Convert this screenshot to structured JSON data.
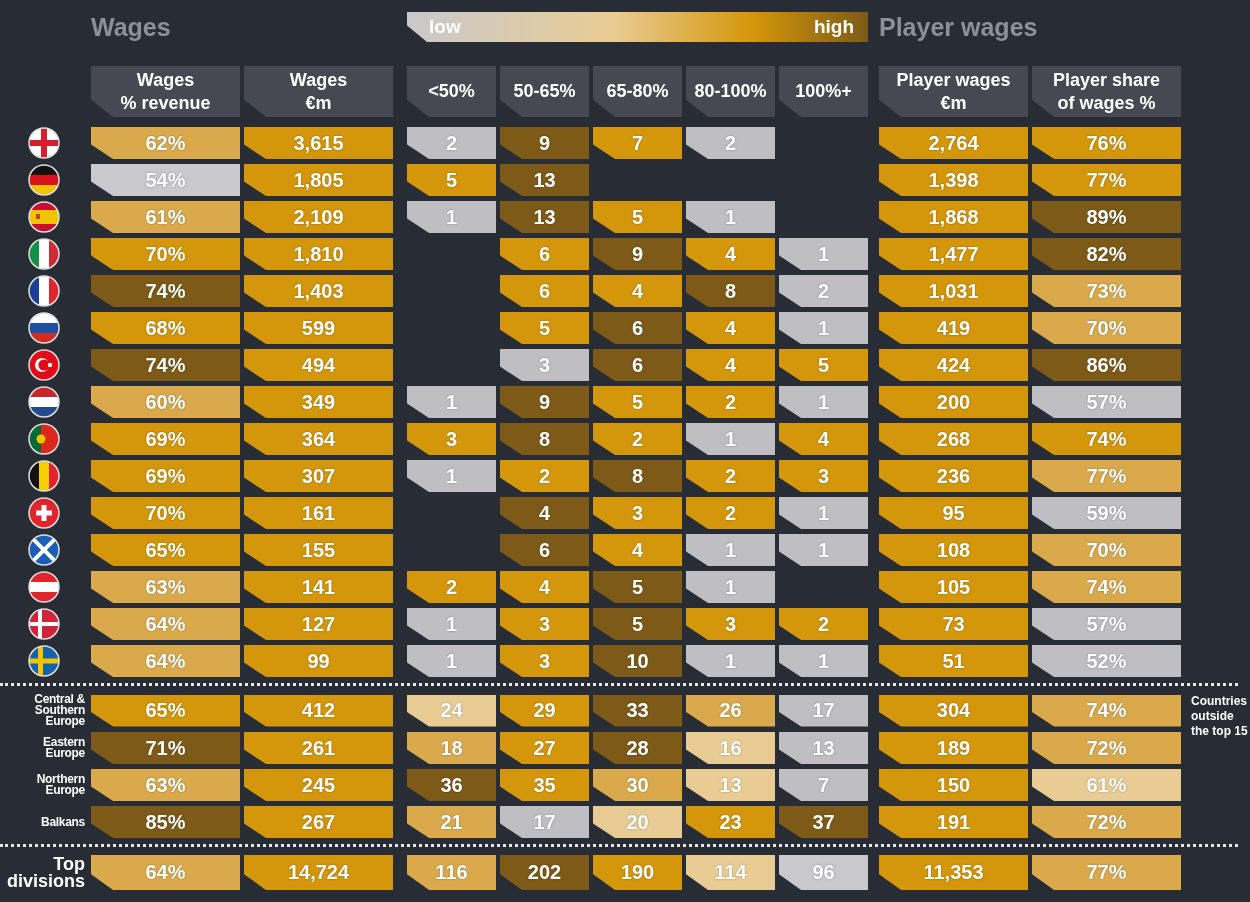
{
  "title": "Wages",
  "legend": {
    "low": "low",
    "high": "high"
  },
  "player_title": "Player wages",
  "columns": [
    "Wages\n% revenue",
    "Wages\n€m",
    "<50%",
    "50-65%",
    "65-80%",
    "80-100%",
    "100%+",
    "Player wages\n€m",
    "Player share\nof wages %"
  ],
  "countries": [
    {
      "cells": [
        {
          "value": "62%",
          "color": "#d9a94c"
        },
        {
          "value": "3,615",
          "color": "#d4960a"
        },
        {
          "value": "2",
          "color": "#bfbfc3"
        },
        {
          "value": "9",
          "color": "#7d5a17"
        },
        {
          "value": "7",
          "color": "#d4960a"
        },
        {
          "value": "2",
          "color": "#bfbfc3"
        },
        null,
        {
          "value": "2,764",
          "color": "#d4960a"
        },
        {
          "value": "76%",
          "color": "#d4960a"
        }
      ]
    },
    {
      "cells": [
        {
          "value": "54%",
          "color": "#c9c9cd"
        },
        {
          "value": "1,805",
          "color": "#d4960a"
        },
        {
          "value": "5",
          "color": "#d4960a"
        },
        {
          "value": "13",
          "color": "#7d5a17"
        },
        null,
        null,
        null,
        {
          "value": "1,398",
          "color": "#d4960a"
        },
        {
          "value": "77%",
          "color": "#d4960a"
        }
      ]
    },
    {
      "cells": [
        {
          "value": "61%",
          "color": "#d9a94c"
        },
        {
          "value": "2,109",
          "color": "#d4960a"
        },
        {
          "value": "1",
          "color": "#bfbfc3"
        },
        {
          "value": "13",
          "color": "#7d5a17"
        },
        {
          "value": "5",
          "color": "#d4960a"
        },
        {
          "value": "1",
          "color": "#bfbfc3"
        },
        null,
        {
          "value": "1,868",
          "color": "#d4960a"
        },
        {
          "value": "89%",
          "color": "#7d5a17"
        }
      ]
    },
    {
      "cells": [
        {
          "value": "70%",
          "color": "#d4960a"
        },
        {
          "value": "1,810",
          "color": "#d4960a"
        },
        null,
        {
          "value": "6",
          "color": "#d4960a"
        },
        {
          "value": "9",
          "color": "#7d5a17"
        },
        {
          "value": "4",
          "color": "#d4960a"
        },
        {
          "value": "1",
          "color": "#bfbfc3"
        },
        {
          "value": "1,477",
          "color": "#d4960a"
        },
        {
          "value": "82%",
          "color": "#7d5a17"
        }
      ]
    },
    {
      "cells": [
        {
          "value": "74%",
          "color": "#7d5a17"
        },
        {
          "value": "1,403",
          "color": "#d4960a"
        },
        null,
        {
          "value": "6",
          "color": "#d4960a"
        },
        {
          "value": "4",
          "color": "#d4960a"
        },
        {
          "value": "8",
          "color": "#7d5a17"
        },
        {
          "value": "2",
          "color": "#bfbfc3"
        },
        {
          "value": "1,031",
          "color": "#d4960a"
        },
        {
          "value": "73%",
          "color": "#d9a94c"
        }
      ]
    },
    {
      "cells": [
        {
          "value": "68%",
          "color": "#d4960a"
        },
        {
          "value": "599",
          "color": "#d4960a"
        },
        null,
        {
          "value": "5",
          "color": "#d4960a"
        },
        {
          "value": "6",
          "color": "#7d5a17"
        },
        {
          "value": "4",
          "color": "#d4960a"
        },
        {
          "value": "1",
          "color": "#bfbfc3"
        },
        {
          "value": "419",
          "color": "#d4960a"
        },
        {
          "value": "70%",
          "color": "#d9a94c"
        }
      ]
    },
    {
      "cells": [
        {
          "value": "74%",
          "color": "#7d5a17"
        },
        {
          "value": "494",
          "color": "#d4960a"
        },
        null,
        {
          "value": "3",
          "color": "#bfbfc3"
        },
        {
          "value": "6",
          "color": "#7d5a17"
        },
        {
          "value": "4",
          "color": "#d4960a"
        },
        {
          "value": "5",
          "color": "#d4960a"
        },
        {
          "value": "424",
          "color": "#d4960a"
        },
        {
          "value": "86%",
          "color": "#7d5a17"
        }
      ]
    },
    {
      "cells": [
        {
          "value": "60%",
          "color": "#d9a94c"
        },
        {
          "value": "349",
          "color": "#d4960a"
        },
        {
          "value": "1",
          "color": "#bfbfc3"
        },
        {
          "value": "9",
          "color": "#7d5a17"
        },
        {
          "value": "5",
          "color": "#d4960a"
        },
        {
          "value": "2",
          "color": "#d4960a"
        },
        {
          "value": "1",
          "color": "#bfbfc3"
        },
        {
          "value": "200",
          "color": "#d4960a"
        },
        {
          "value": "57%",
          "color": "#bfbfc3"
        }
      ]
    },
    {
      "cells": [
        {
          "value": "69%",
          "color": "#d4960a"
        },
        {
          "value": "364",
          "color": "#d4960a"
        },
        {
          "value": "3",
          "color": "#d4960a"
        },
        {
          "value": "8",
          "color": "#7d5a17"
        },
        {
          "value": "2",
          "color": "#d4960a"
        },
        {
          "value": "1",
          "color": "#bfbfc3"
        },
        {
          "value": "4",
          "color": "#d4960a"
        },
        {
          "value": "268",
          "color": "#d4960a"
        },
        {
          "value": "74%",
          "color": "#d4960a"
        }
      ]
    },
    {
      "cells": [
        {
          "value": "69%",
          "color": "#d4960a"
        },
        {
          "value": "307",
          "color": "#d4960a"
        },
        {
          "value": "1",
          "color": "#bfbfc3"
        },
        {
          "value": "2",
          "color": "#d4960a"
        },
        {
          "value": "8",
          "color": "#7d5a17"
        },
        {
          "value": "2",
          "color": "#d4960a"
        },
        {
          "value": "3",
          "color": "#d4960a"
        },
        {
          "value": "236",
          "color": "#d4960a"
        },
        {
          "value": "77%",
          "color": "#d9a94c"
        }
      ]
    },
    {
      "cells": [
        {
          "value": "70%",
          "color": "#d4960a"
        },
        {
          "value": "161",
          "color": "#d4960a"
        },
        null,
        {
          "value": "4",
          "color": "#7d5a17"
        },
        {
          "value": "3",
          "color": "#d4960a"
        },
        {
          "value": "2",
          "color": "#d4960a"
        },
        {
          "value": "1",
          "color": "#bfbfc3"
        },
        {
          "value": "95",
          "color": "#d4960a"
        },
        {
          "value": "59%",
          "color": "#bfbfc3"
        }
      ]
    },
    {
      "cells": [
        {
          "value": "65%",
          "color": "#d4960a"
        },
        {
          "value": "155",
          "color": "#d4960a"
        },
        null,
        {
          "value": "6",
          "color": "#7d5a17"
        },
        {
          "value": "4",
          "color": "#d4960a"
        },
        {
          "value": "1",
          "color": "#bfbfc3"
        },
        {
          "value": "1",
          "color": "#bfbfc3"
        },
        {
          "value": "108",
          "color": "#d4960a"
        },
        {
          "value": "70%",
          "color": "#d9a94c"
        }
      ]
    },
    {
      "cells": [
        {
          "value": "63%",
          "color": "#d9a94c"
        },
        {
          "value": "141",
          "color": "#d4960a"
        },
        {
          "value": "2",
          "color": "#d4960a"
        },
        {
          "value": "4",
          "color": "#d4960a"
        },
        {
          "value": "5",
          "color": "#7d5a17"
        },
        {
          "value": "1",
          "color": "#bfbfc3"
        },
        null,
        {
          "value": "105",
          "color": "#d4960a"
        },
        {
          "value": "74%",
          "color": "#d9a94c"
        }
      ]
    },
    {
      "cells": [
        {
          "value": "64%",
          "color": "#d9a94c"
        },
        {
          "value": "127",
          "color": "#d4960a"
        },
        {
          "value": "1",
          "color": "#bfbfc3"
        },
        {
          "value": "3",
          "color": "#d4960a"
        },
        {
          "value": "5",
          "color": "#7d5a17"
        },
        {
          "value": "3",
          "color": "#d4960a"
        },
        {
          "value": "2",
          "color": "#d4960a"
        },
        {
          "value": "73",
          "color": "#d4960a"
        },
        {
          "value": "57%",
          "color": "#bfbfc3"
        }
      ]
    },
    {
      "cells": [
        {
          "value": "64%",
          "color": "#d9a94c"
        },
        {
          "value": "99",
          "color": "#d4960a"
        },
        {
          "value": "1",
          "color": "#bfbfc3"
        },
        {
          "value": "3",
          "color": "#d4960a"
        },
        {
          "value": "10",
          "color": "#7d5a17"
        },
        {
          "value": "1",
          "color": "#bfbfc3"
        },
        {
          "value": "1",
          "color": "#bfbfc3"
        },
        {
          "value": "51",
          "color": "#d4960a"
        },
        {
          "value": "52%",
          "color": "#bfbfc3"
        }
      ]
    }
  ],
  "regions": [
    {
      "label": "Central &\nSouthern\nEurope",
      "cells": [
        {
          "value": "65%",
          "color": "#d4960a"
        },
        {
          "value": "412",
          "color": "#d4960a"
        },
        {
          "value": "24",
          "color": "#e9cc94"
        },
        {
          "value": "29",
          "color": "#d4960a"
        },
        {
          "value": "33",
          "color": "#7d5a17"
        },
        {
          "value": "26",
          "color": "#d9a94c"
        },
        {
          "value": "17",
          "color": "#bfbfc3"
        },
        {
          "value": "304",
          "color": "#d4960a"
        },
        {
          "value": "74%",
          "color": "#d9a94c"
        }
      ]
    },
    {
      "label": "Eastern\nEurope",
      "cells": [
        {
          "value": "71%",
          "color": "#7d5a17"
        },
        {
          "value": "261",
          "color": "#d4960a"
        },
        {
          "value": "18",
          "color": "#d9a94c"
        },
        {
          "value": "27",
          "color": "#d4960a"
        },
        {
          "value": "28",
          "color": "#7d5a17"
        },
        {
          "value": "16",
          "color": "#e9cc94"
        },
        {
          "value": "13",
          "color": "#bfbfc3"
        },
        {
          "value": "189",
          "color": "#d4960a"
        },
        {
          "value": "72%",
          "color": "#d9a94c"
        }
      ]
    },
    {
      "label": "Northern\nEurope",
      "cells": [
        {
          "value": "63%",
          "color": "#d9a94c"
        },
        {
          "value": "245",
          "color": "#d4960a"
        },
        {
          "value": "36",
          "color": "#7d5a17"
        },
        {
          "value": "35",
          "color": "#d4960a"
        },
        {
          "value": "30",
          "color": "#d9a94c"
        },
        {
          "value": "13",
          "color": "#e9cc94"
        },
        {
          "value": "7",
          "color": "#bfbfc3"
        },
        {
          "value": "150",
          "color": "#d4960a"
        },
        {
          "value": "61%",
          "color": "#e9cc94"
        }
      ]
    },
    {
      "label": "Balkans",
      "cells": [
        {
          "value": "85%",
          "color": "#7d5a17"
        },
        {
          "value": "267",
          "color": "#d4960a"
        },
        {
          "value": "21",
          "color": "#d9a94c"
        },
        {
          "value": "17",
          "color": "#bfbfc3"
        },
        {
          "value": "20",
          "color": "#e9cc94"
        },
        {
          "value": "23",
          "color": "#d4960a"
        },
        {
          "value": "37",
          "color": "#7d5a17"
        },
        {
          "value": "191",
          "color": "#d4960a"
        },
        {
          "value": "72%",
          "color": "#d9a94c"
        }
      ]
    }
  ],
  "regions_note": "Countries outside the top 15",
  "total": {
    "label": "Top\ndivisions",
    "cells": [
      {
        "value": "64%",
        "color": "#d9a94c"
      },
      {
        "value": "14,724",
        "color": "#d4960a"
      },
      {
        "value": "116",
        "color": "#d9a94c"
      },
      {
        "value": "202",
        "color": "#7d5a17"
      },
      {
        "value": "190",
        "color": "#d4960a"
      },
      {
        "value": "114",
        "color": "#e9cc94"
      },
      {
        "value": "96",
        "color": "#c9c9cd"
      },
      {
        "value": "11,353",
        "color": "#d4960a"
      },
      {
        "value": "77%",
        "color": "#d9a94c"
      }
    ]
  }
}
